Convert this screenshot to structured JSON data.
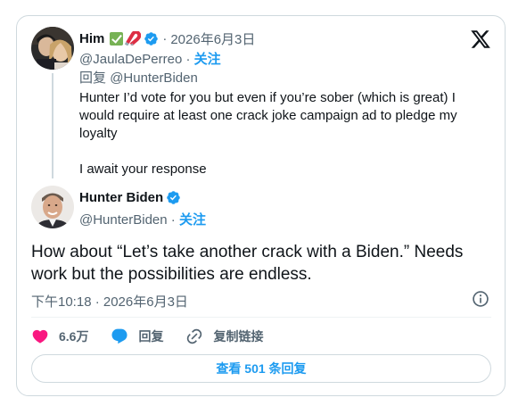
{
  "parent_tweet": {
    "name": "Him",
    "date": "2026年6月3日",
    "handle": "@JaulaDePerreo",
    "follow_label": "关注",
    "reply_prefix": "回复",
    "reply_to": "@HunterBiden",
    "text_line1": "Hunter I’d vote for you but even if you’re sober (which is great) I would require at least one crack joke campaign ad to pledge my loyalty",
    "text_line2": "I await your response"
  },
  "main_tweet": {
    "name": "Hunter Biden",
    "handle": "@HunterBiden",
    "follow_label": "关注",
    "text": "How about “Let’s take another crack with a Biden.” Needs work but the possibilities are endless.",
    "timestamp": "下午10:18 · 2026年6月3日"
  },
  "actions": {
    "likes": "6.6万",
    "reply_label": "回复",
    "copy_link_label": "复制链接"
  },
  "read_replies_label": "查看 501 条回复",
  "colors": {
    "accent": "#1d9bf0",
    "like": "#f91880",
    "secondary_text": "#536471",
    "border": "#cfd9de"
  }
}
